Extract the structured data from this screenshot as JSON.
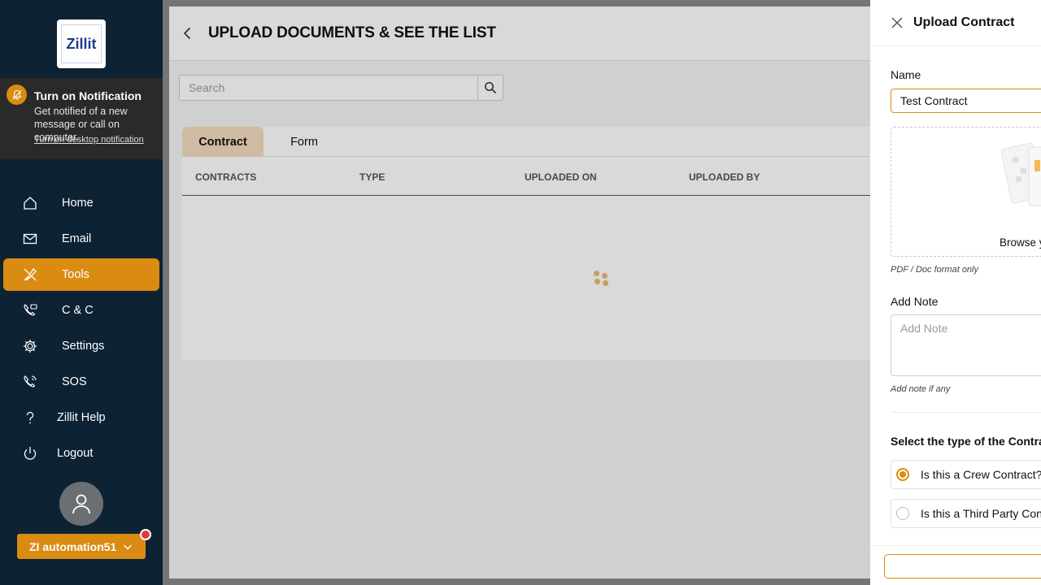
{
  "brand": {
    "logo_text": "Zillit"
  },
  "notification": {
    "title": "Turn on Notification",
    "message": "Get notified of a new message or call on computer.",
    "link": "Turn on desktop notification"
  },
  "sidebar": {
    "items": [
      {
        "label": "Home",
        "icon": "home-icon"
      },
      {
        "label": "Email",
        "icon": "mail-icon"
      },
      {
        "label": "Tools",
        "icon": "tools-icon",
        "active": true
      },
      {
        "label": "C & C",
        "icon": "phone-chat-icon"
      },
      {
        "label": "Settings",
        "icon": "gear-icon"
      },
      {
        "label": "SOS",
        "icon": "sos-phone-icon"
      },
      {
        "label": "Zillit Help",
        "icon": "question-icon"
      },
      {
        "label": "Logout",
        "icon": "power-icon"
      }
    ]
  },
  "user": {
    "name": "ZI automation51",
    "icon": "user-avatar-icon"
  },
  "page": {
    "title": "UPLOAD DOCUMENTS & SEE THE LIST",
    "search_placeholder": "Search",
    "tabs": [
      {
        "label": "Contract",
        "active": true
      },
      {
        "label": "Form",
        "active": false
      }
    ],
    "columns": [
      "CONTRACTS",
      "TYPE",
      "UPLOADED ON",
      "UPLOADED BY"
    ]
  },
  "drawer": {
    "title": "Upload Contract",
    "name_label": "Name",
    "name_value": "Test Contract",
    "browse_text": "Browse y",
    "format_hint": "PDF / Doc format only",
    "note_label": "Add Note",
    "note_placeholder": "Add Note",
    "note_hint": "Add note if any",
    "type_title": "Select the type of the Contrac",
    "options": [
      {
        "label": "Is this a Crew Contract?",
        "selected": true
      },
      {
        "label": "Is this a Third Party Contr",
        "selected": false
      }
    ]
  },
  "colors": {
    "accent": "#d98b12",
    "sidebar_bg": "#0d2233",
    "tab_active_bg": "#f4dcbf"
  }
}
